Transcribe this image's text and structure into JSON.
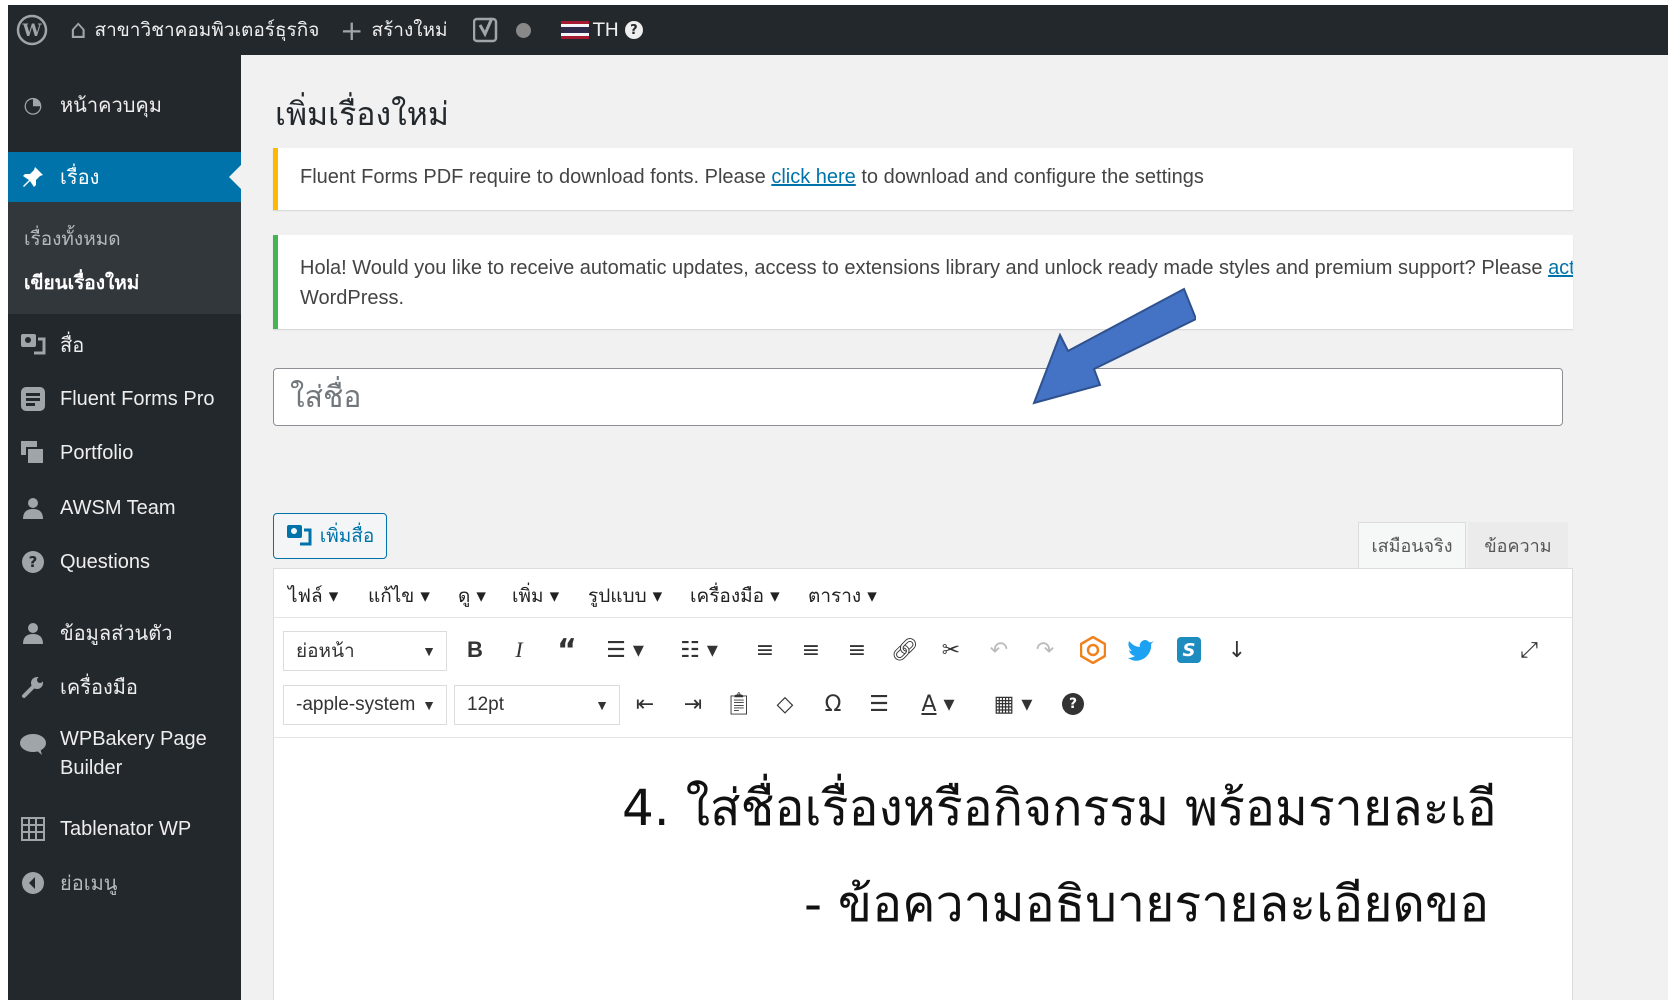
{
  "admin_bar": {
    "site_name": "สาขาวิชาคอมพิวเตอร์ธุรกิจ",
    "new_label": "สร้างใหม่",
    "language": "TH"
  },
  "sidebar": {
    "items": [
      {
        "label": "หน้าควบคุม",
        "icon": "dashboard-icon"
      },
      {
        "label": "เรื่อง",
        "icon": "pin-icon"
      },
      {
        "label": "สื่อ",
        "icon": "media-icon"
      },
      {
        "label": "Fluent Forms Pro",
        "icon": "forms-icon"
      },
      {
        "label": "Portfolio",
        "icon": "portfolio-icon"
      },
      {
        "label": "AWSM Team",
        "icon": "user-icon"
      },
      {
        "label": "Questions",
        "icon": "question-icon"
      },
      {
        "label": "ข้อมูลส่วนตัว",
        "icon": "user-icon"
      },
      {
        "label": "เครื่องมือ",
        "icon": "wrench-icon"
      },
      {
        "label": "WPBakery Page Builder",
        "icon": "cloud-icon"
      },
      {
        "label": "Tablenator WP",
        "icon": "table-icon"
      },
      {
        "label": "ย่อเมนู",
        "icon": "collapse-icon"
      }
    ],
    "submenu": [
      "เรื่องทั้งหมด",
      "เขียนเรื่องใหม่"
    ]
  },
  "page": {
    "title": "เพิ่มเรื่องใหม่",
    "notice1_before": "Fluent Forms PDF require to download fonts. Please ",
    "notice1_link": "click here",
    "notice1_after": " to download and configure the settings",
    "notice2_line1": "Hola! Would you like to receive automatic updates, access to extensions library and unlock ready made styles and premium support? Please ",
    "notice2_link": "activate yo",
    "notice2_line2": "WordPress.",
    "title_placeholder": "ใส่ชื่อ"
  },
  "editor": {
    "add_media": "เพิ่มสื่อ",
    "tabs": [
      "เสมือนจริง",
      "ข้อความ"
    ],
    "menus": [
      "ไฟล์ ▾",
      "แก้ไข ▾",
      "ดู ▾",
      "เพิ่ม ▾",
      "รูปแบบ ▾",
      "เครื่องมือ ▾",
      "ตาราง ▾"
    ],
    "format_select": "ย่อหน้า",
    "font_select": "-apple-system",
    "size_select": "12pt"
  },
  "content": {
    "line1": "4. ใส่ชื่อเรื่องหรือกิจกรรม  พร้อมรายละเอี",
    "line2": "- ข้อความอธิบายรายละเอียดขอ"
  },
  "colors": {
    "admin_bar": "#23282d",
    "active_menu": "#0073aa",
    "arrow": "#4472c4",
    "notice_warning": "#ffb900",
    "notice_success": "#46b450"
  }
}
